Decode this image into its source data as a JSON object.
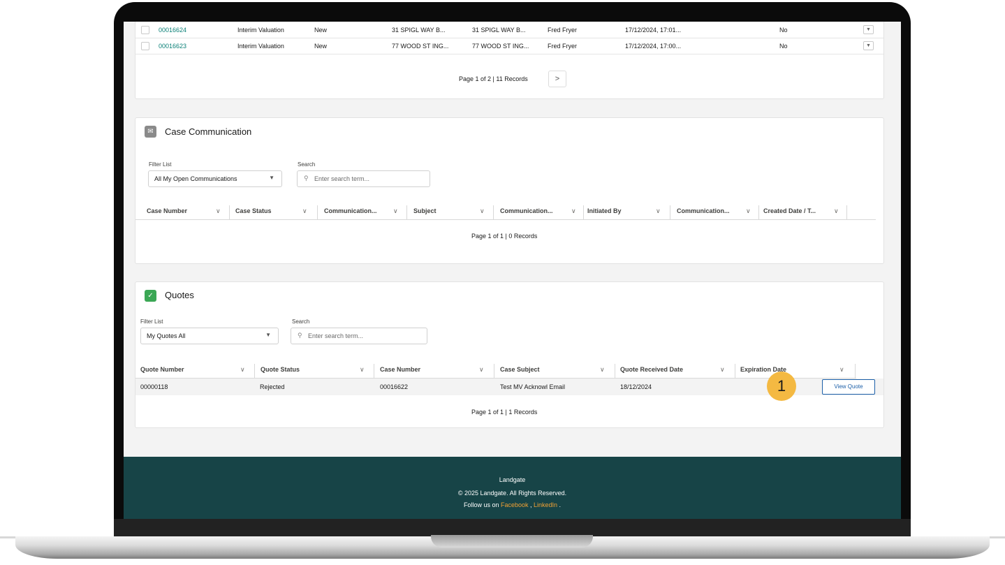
{
  "top_table": {
    "rows": [
      {
        "number": "00016624",
        "type": "Interim Valuation",
        "status": "New",
        "address1": "31 SPIGL WAY B...",
        "address2": "31 SPIGL WAY B...",
        "owner": "Fred Fryer",
        "date": "17/12/2024, 17:01...",
        "flag": "No"
      },
      {
        "number": "00016623",
        "type": "Interim Valuation",
        "status": "New",
        "address1": "77 WOOD ST ING...",
        "address2": "77 WOOD ST ING...",
        "owner": "Fred Fryer",
        "date": "17/12/2024, 17:00...",
        "flag": "No"
      }
    ],
    "pager": "Page 1 of 2 | 11 Records",
    "next": ">"
  },
  "case_communication": {
    "title": "Case Communication",
    "filter_label": "Filter List",
    "filter_value": "All My Open Communications",
    "search_label": "Search",
    "search_placeholder": "Enter search term...",
    "columns": [
      "Case Number",
      "Case Status",
      "Communication...",
      "Subject",
      "Communication...",
      "Initiated By",
      "Communication...",
      "Created Date / T..."
    ],
    "pager": "Page 1 of 1 | 0 Records"
  },
  "quotes": {
    "title": "Quotes",
    "filter_label": "Filter List",
    "filter_value": "My Quotes All",
    "search_label": "Search",
    "search_placeholder": "Enter search term...",
    "columns": [
      "Quote Number",
      "Quote Status",
      "Case Number",
      "Case Subject",
      "Quote Received Date",
      "Expiration Date"
    ],
    "row": {
      "quote_number": "00000118",
      "status": "Rejected",
      "case_number": "00016622",
      "subject": "Test MV Acknowl Email",
      "received": "18/12/2024"
    },
    "view_button": "View Quote",
    "pager": "Page 1 of 1 | 1 Records"
  },
  "marker": "1",
  "footer": {
    "brand": "Landgate",
    "copyright": "© 2025 Landgate. All Rights Reserved.",
    "follow_prefix": "Follow us on ",
    "facebook": "Facebook",
    "sep": " , ",
    "linkedin": "LinkedIn",
    "suffix": " ."
  },
  "colors": {
    "footer_bg": "#174447",
    "link": "#0b8177",
    "accent": "#f2a134",
    "marker": "#f4b942"
  }
}
